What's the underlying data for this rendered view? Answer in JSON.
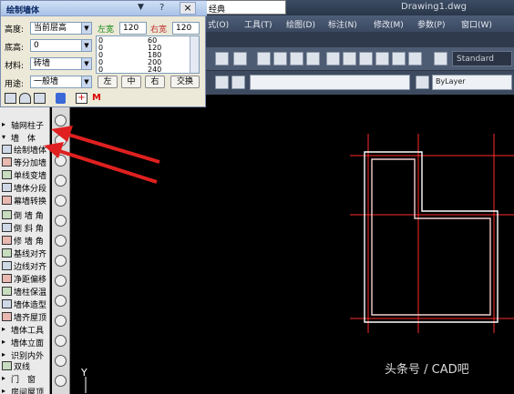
{
  "window": {
    "document_title": "Drawing1.dwg",
    "style_combo": "经典"
  },
  "menu": [
    "式(O)",
    "工具(T)",
    "绘图(D)",
    "标注(N)",
    "修改(M)",
    "参数(P)",
    "窗口(W)"
  ],
  "toolbar": {
    "text_style": "Standard",
    "layer": "ByLayer"
  },
  "dialog": {
    "title": "绘制墙体",
    "height_label": "高度:",
    "height_value": "当前层高",
    "base_label": "底高:",
    "base_value": "0",
    "material_label": "材料:",
    "material_value": "砖墙",
    "usage_label": "用途:",
    "usage_value": "一般墙",
    "left_width_label": "左宽",
    "left_width_value": "120",
    "right_width_label": "右宽",
    "right_width_value": "120",
    "width_list": [
      {
        "left": "0",
        "right": "60"
      },
      {
        "left": "0",
        "right": "120"
      },
      {
        "left": "0",
        "right": "180"
      },
      {
        "left": "0",
        "right": "200"
      },
      {
        "left": "0",
        "right": "240"
      }
    ],
    "buttons": {
      "left": "左",
      "center": "中",
      "right": "右",
      "swap": "交换"
    },
    "help_glyph": "?",
    "close_glyph": "×"
  },
  "left_panel": {
    "items": [
      {
        "label": "轴网柱子",
        "icon": "expand-arrow-icon"
      },
      {
        "label": "墙　体",
        "icon": "collapse-arrow-icon"
      },
      {
        "label": "绘制墙体",
        "icon": "draw-wall-icon"
      },
      {
        "label": "等分加墙",
        "icon": "divide-wall-icon"
      },
      {
        "label": "单线变墙",
        "icon": "line-to-wall-icon"
      },
      {
        "label": "墙体分段",
        "icon": "wall-segment-icon"
      },
      {
        "label": "幕墙转换",
        "icon": "curtain-wall-icon"
      },
      {
        "label": "倒 墙 角",
        "icon": "fillet-wall-icon"
      },
      {
        "label": "倒 斜 角",
        "icon": "chamfer-wall-icon"
      },
      {
        "label": "修 墙 角",
        "icon": "trim-wall-icon"
      },
      {
        "label": "基线对齐",
        "icon": "baseline-align-icon"
      },
      {
        "label": "边线对齐",
        "icon": "edge-align-icon"
      },
      {
        "label": "净距偏移",
        "icon": "offset-icon"
      },
      {
        "label": "墙柱保温",
        "icon": "insulation-icon"
      },
      {
        "label": "墙体造型",
        "icon": "wall-shape-icon"
      },
      {
        "label": "墙齐屋顶",
        "icon": "wall-roof-icon"
      },
      {
        "label": "墙体工具",
        "icon": "expand-arrow-icon"
      },
      {
        "label": "墙体立面",
        "icon": "expand-arrow-icon"
      },
      {
        "label": "识别内外",
        "icon": "expand-arrow-icon"
      },
      {
        "label": "双线",
        "icon": "double-line-icon"
      },
      {
        "label": "门　窗",
        "icon": "expand-arrow-icon"
      },
      {
        "label": "房间屋顶",
        "icon": "expand-arrow-icon"
      }
    ]
  },
  "canvas": {
    "y_axis_label": "Y",
    "line_color": "#ff2020",
    "wall_color": "#ffffff"
  },
  "watermark": "头条号 / CAD吧",
  "colors": {
    "annotation_arrow": "#e02020",
    "dialog_bg": "#ece9d8",
    "canvas_bg": "#000000"
  }
}
